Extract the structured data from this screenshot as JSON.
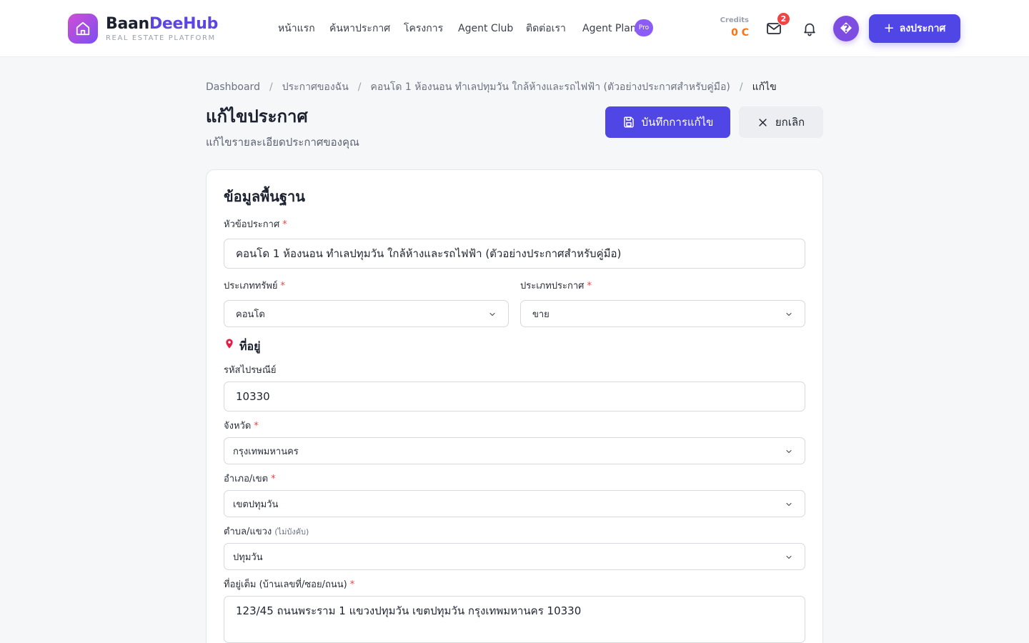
{
  "brand": {
    "name_part1": "Baan",
    "name_part2": "DeeHub",
    "tagline": "REAL ESTATE PLATFORM",
    "accent": "#4f46e5"
  },
  "nav": {
    "items": [
      {
        "label": "หน้าแรก"
      },
      {
        "label": "ค้นหาประกาศ"
      },
      {
        "label": "โครงการ"
      },
      {
        "label": "Agent Club"
      },
      {
        "label": "ติดต่อเรา"
      },
      {
        "label": "Agent Plan"
      }
    ],
    "pro_badge": "Pro"
  },
  "header": {
    "credits_label": "Credits",
    "credits_value": "0 C",
    "mail_count": "2",
    "avatar_glyph": "�",
    "post_button": "ลงประกาศ"
  },
  "breadcrumb": {
    "items": [
      "Dashboard",
      "ประกาศของฉัน",
      "คอนโด 1 ห้องนอน ทำเลปทุมวัน ใกล้ห้างและรถไฟฟ้า (ตัวอย่างประกาศสำหรับคู่มือ)"
    ],
    "current": "แก้ไข",
    "separator": "/"
  },
  "page": {
    "title": "แก้ไขประกาศ",
    "subtitle": "แก้ไขรายละเอียดประกาศของคุณ",
    "save_button": "บันทึกการแก้ไข",
    "cancel_button": "ยกเลิก"
  },
  "form": {
    "section_title": "ข้อมูลพื้นฐาน",
    "title_label": "หัวข้อประกาศ",
    "title_value": "คอนโด 1 ห้องนอน ทำเลปทุมวัน ใกล้ห้างและรถไฟฟ้า (ตัวอย่างประกาศสำหรับคู่มือ)",
    "property_type_label": "ประเภททรัพย์",
    "property_type_value": "คอนโด",
    "listing_type_label": "ประเภทประกาศ",
    "listing_type_value": "ขาย",
    "address_heading": "ที่อยู่",
    "postal_label": "รหัสไปรษณีย์",
    "postal_value": "10330",
    "province_label": "จังหวัด",
    "province_value": "กรุงเทพมหานคร",
    "district_label": "อำเภอ/เขต",
    "district_value": "เขตปทุมวัน",
    "subdistrict_label": "ตำบล/แขวง",
    "subdistrict_optional": "(ไม่บังคับ)",
    "subdistrict_value": "ปทุมวัน",
    "full_address_label": "ที่อยู่เต็ม (บ้านเลขที่/ซอย/ถนน)",
    "full_address_value": "123/45 ถนนพระราม 1 แขวงปทุมวัน เขตปทุมวัน กรุงเทพมหานคร 10330",
    "required_mark": "*"
  }
}
